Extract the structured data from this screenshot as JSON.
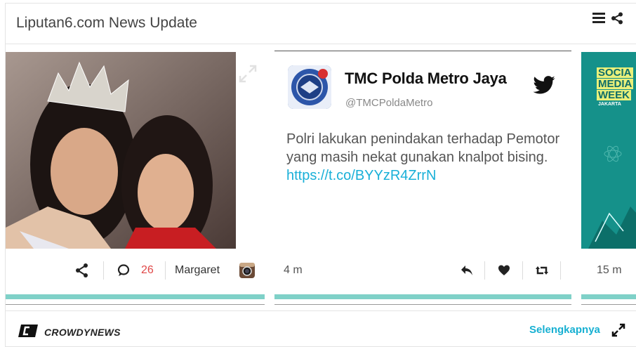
{
  "header": {
    "title": "Liputan6.com News Update",
    "menu_icon": "hamburger-icon",
    "share_icon": "share-icon"
  },
  "cards": [
    {
      "type": "instagram",
      "photo_icon": "photo",
      "comment_count": "26",
      "author": "Margaret",
      "source_icon": "instagram-icon"
    },
    {
      "type": "tweet",
      "name": "TMC Polda Metro Jaya",
      "handle": "@TMCPoldaMetro",
      "text": "Polri lakukan penindakan terhadap Pemotor yang masih nekat gunakan knalpot bising.",
      "link": "https://t.co/BYYzR4ZrrN",
      "time": "4 m"
    },
    {
      "type": "image",
      "lines": [
        "SOCIA",
        "MEDIA",
        "WEEK",
        "JAKARTA"
      ],
      "time": "15 m"
    }
  ],
  "footer": {
    "brand": "CROWDYNEWS",
    "more_label": "Selengkapnya"
  },
  "colors": {
    "accent": "#7fd1c8",
    "link": "#1ab0d8",
    "comment_count": "#e04848"
  }
}
